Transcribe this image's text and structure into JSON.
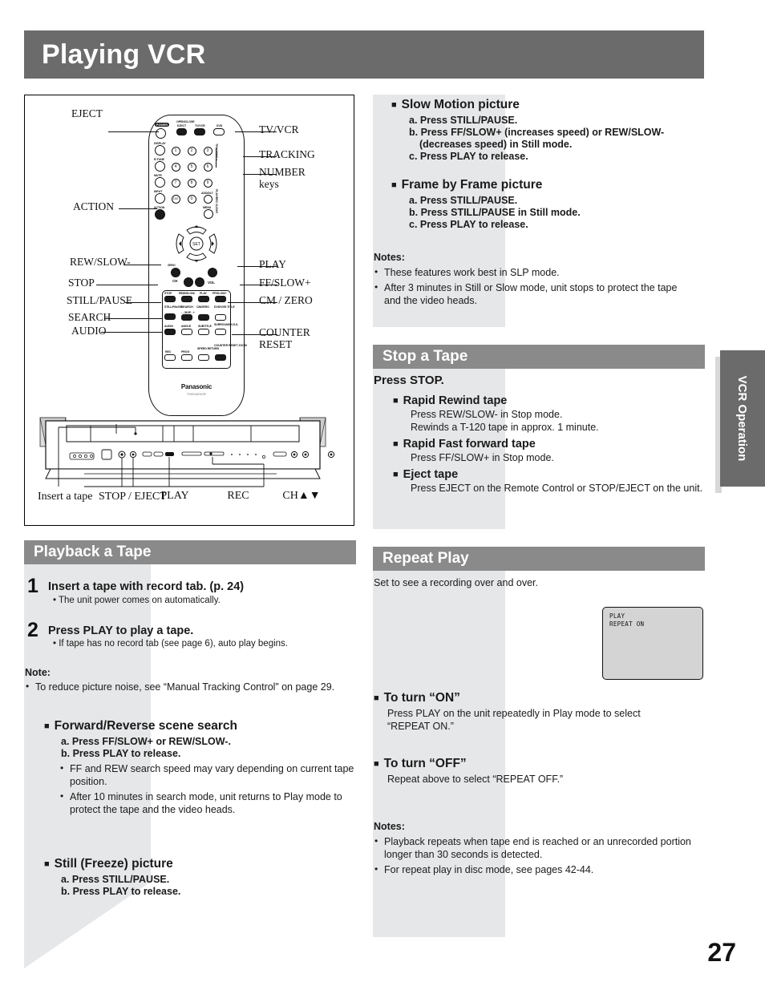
{
  "page": {
    "title": "Playing VCR",
    "number": "27",
    "side_tab": "VCR Operation"
  },
  "diagram": {
    "remote": {
      "brand": "Panasonic",
      "model": "TV/DVD/VCR",
      "top_row": [
        {
          "label": "POWER",
          "type": "pill-dark"
        },
        {
          "label": "OPEN/CLOSE",
          "type": "text"
        },
        {
          "label": "EJECT",
          "type": "button"
        },
        {
          "label": "TV/VCR",
          "type": "button"
        },
        {
          "label": "DVD",
          "type": "button"
        }
      ],
      "left_column": [
        "DISPLAY",
        "R-TUNE",
        "MUTE",
        "INPUT",
        "ACTION"
      ],
      "number_keys": [
        "1",
        "2",
        "3",
        "4",
        "5",
        "6",
        "7",
        "8",
        "9",
        "100",
        "0"
      ],
      "right_column": [
        "ADD/DLT",
        "MENU"
      ],
      "side_labels": [
        "TRACKING +",
        "TRACKING -",
        "PLAY/REC CLEAR"
      ],
      "dpad_center": "SET",
      "ch_label": "CH",
      "vol_label": "VOL",
      "skip_label": "- - SKIP - +",
      "transport_row": [
        "STOP",
        "REW/SLOW-",
        "PLAY",
        "FF/SLOW+"
      ],
      "row2": [
        "STILL/PAUSE",
        "SEARCH",
        "CM/ZERO",
        "DVD/VHS TITLE"
      ],
      "row3": [
        "AUDIO",
        "ANGLE",
        "SUBTITLE",
        "SURROUND V.S.S."
      ],
      "row4": [
        "REC",
        "PROG",
        "SPEED RETURN",
        "COUNTER RESET ZOOM"
      ]
    },
    "callouts_left": [
      "EJECT",
      "ACTION",
      "REW/SLOW-",
      "STOP",
      "STILL/PAUSE",
      "SEARCH",
      "AUDIO"
    ],
    "callouts_right": [
      "TV/VCR",
      "TRACKING",
      "NUMBER keys",
      "PLAY",
      "FF/SLOW+",
      "CM / ZERO",
      "COUNTER RESET"
    ],
    "unit_labels": [
      "Insert a tape",
      "STOP / EJECT",
      "PLAY",
      "REC",
      "CH▲▼"
    ]
  },
  "slow_motion": {
    "heading": "Slow Motion picture",
    "steps": [
      "a. Press STILL/PAUSE.",
      "b. Press FF/SLOW+ (increases speed) or REW/SLOW-",
      "(decreases speed) in Still mode.",
      "c. Press PLAY to release."
    ]
  },
  "frame_by_frame": {
    "heading": "Frame by Frame picture",
    "steps": [
      "a. Press STILL/PAUSE.",
      "b. Press STILL/PAUSE in Still mode.",
      "c. Press PLAY to release."
    ]
  },
  "notes_top": {
    "label": "Notes:",
    "items": [
      "These features work best in SLP mode.",
      "After 3 minutes in Still or Slow mode, unit stops to protect the tape and the video heads."
    ]
  },
  "stop_a_tape": {
    "title": "Stop a Tape",
    "intro": "Press STOP.",
    "blocks": [
      {
        "heading": "Rapid Rewind tape",
        "lines": [
          "Press REW/SLOW- in Stop mode.",
          "Rewinds a T-120 tape in approx. 1 minute."
        ]
      },
      {
        "heading": "Rapid Fast forward tape",
        "lines": [
          "Press FF/SLOW+ in Stop mode."
        ]
      },
      {
        "heading": "Eject tape",
        "lines": [
          "Press EJECT on the Remote Control or STOP/EJECT on the unit."
        ]
      }
    ]
  },
  "playback_a_tape": {
    "title": "Playback a Tape",
    "steps": [
      {
        "num": "1",
        "title": "Insert a tape with record tab. (p. 24)",
        "sub": "• The unit power comes on automatically."
      },
      {
        "num": "2",
        "title": "Press PLAY to play a tape.",
        "sub": "• If tape has no record tab (see page 6), auto play begins."
      }
    ],
    "note_label": "Note:",
    "note_item": "To reduce picture noise, see “Manual Tracking Control” on page 29.",
    "scene_search": {
      "heading": "Forward/Reverse scene search",
      "steps": [
        "a. Press FF/SLOW+ or REW/SLOW-.",
        "b. Press PLAY to release."
      ],
      "bullets": [
        "FF and REW search speed may vary depending on current tape position.",
        "After 10 minutes in search mode, unit returns to Play mode to protect the tape and the video heads."
      ]
    },
    "still_picture": {
      "heading": "Still (Freeze) picture",
      "steps": [
        "a. Press STILL/PAUSE.",
        "b. Press PLAY to release."
      ]
    }
  },
  "repeat_play": {
    "title": "Repeat Play",
    "intro": "Set to see a recording over and over.",
    "osd": {
      "line1": "PLAY",
      "line2": "REPEAT ON"
    },
    "turn_on": {
      "heading": "To turn “ON”",
      "lines": [
        "Press PLAY on the unit repeatedly in Play mode to select",
        "“REPEAT ON.”"
      ]
    },
    "turn_off": {
      "heading": "To turn “OFF”",
      "lines": [
        "Repeat above to select “REPEAT OFF.”"
      ]
    },
    "notes": {
      "label": "Notes:",
      "items": [
        "Playback repeats when tape end is reached or an unrecorded portion longer than 30 seconds is detected.",
        "For repeat play in disc mode, see pages 42-44."
      ]
    }
  },
  "colors": {
    "title_bar": "#6b6b6b",
    "section_bar": "#8a8a8a",
    "shade": "#e6e7e8",
    "osd_bg": "#d4d4d4"
  }
}
